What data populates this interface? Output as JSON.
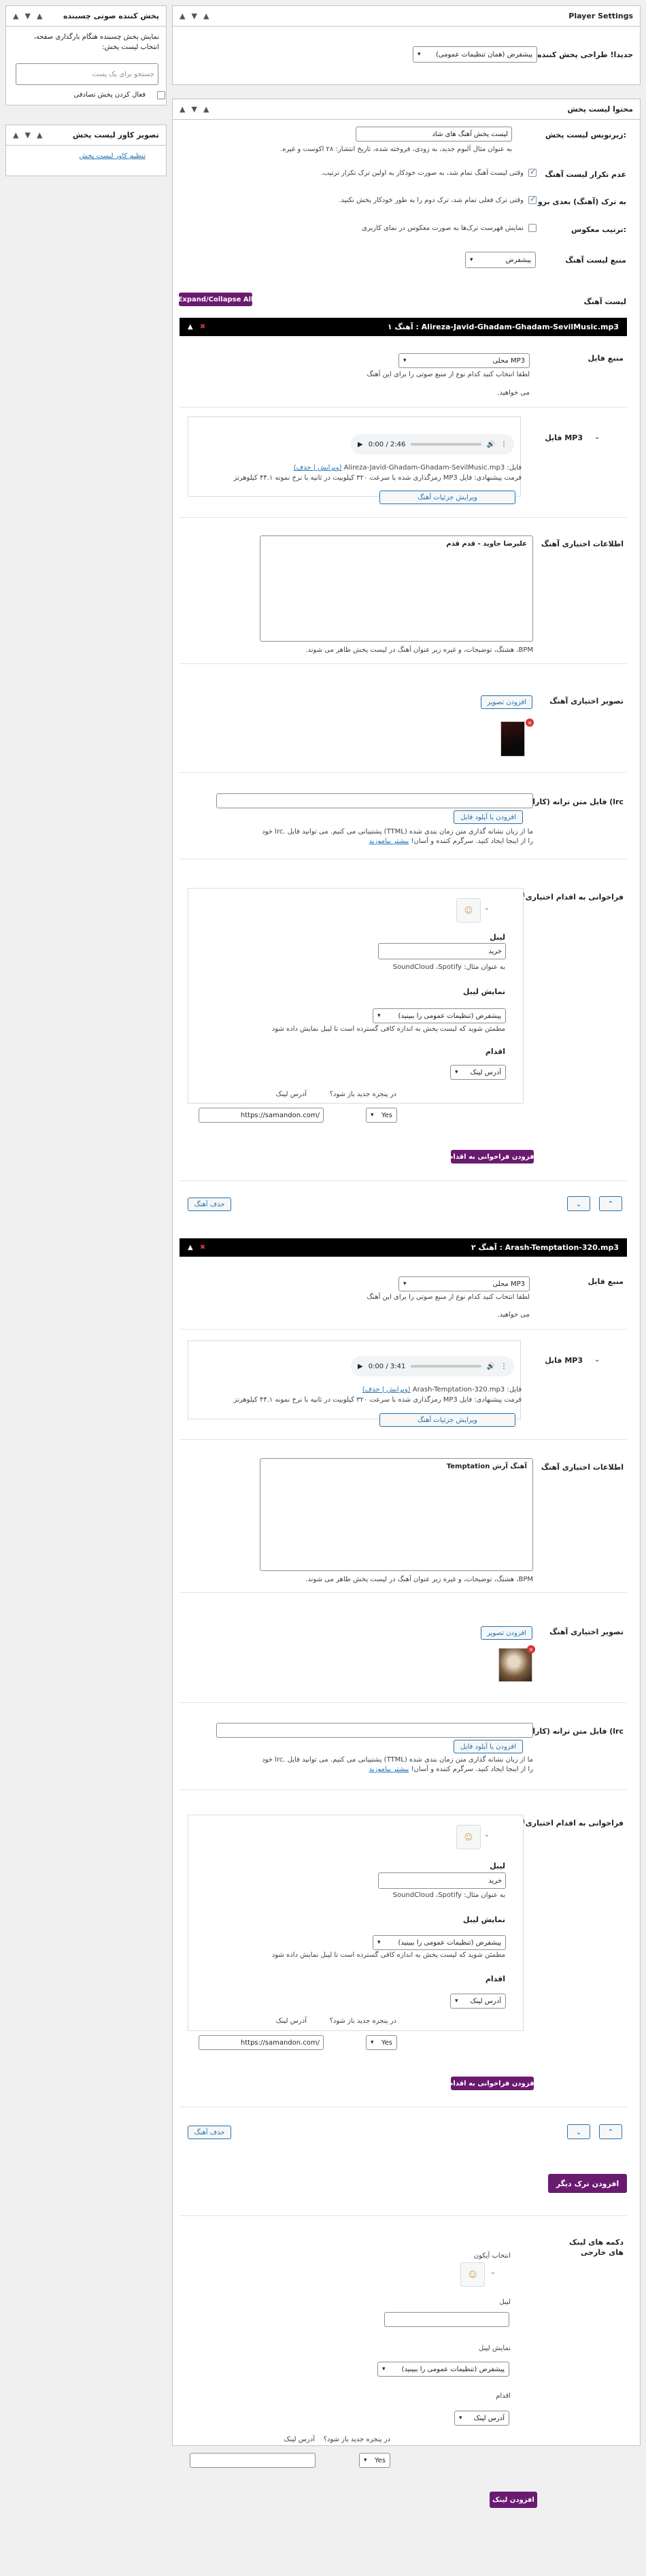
{
  "sidebar": {
    "sticky_panel": {
      "title": "پخش کننده صوتی چسبنده",
      "description": "نمایش پخش چسبنده هنگام بارگذاری صفحه، انتخاب لیست پخش:",
      "search_placeholder": "جستجو برای یک پست",
      "checkbox_label": "فعال کردن پخش تصادفی"
    },
    "cover_panel": {
      "title": "تصویر کاور لیست پخش",
      "link": "تنظیم کاور لیست پخش"
    }
  },
  "player_settings": {
    "title": "Player Settings",
    "row_label": "جدیدا! طراحی پخش کننده",
    "select_value": "پیشفرض (همان تنظیمات عمومی)"
  },
  "playlist_content": {
    "title": "محتوا لیست پخش",
    "subtitle_label": "زیرنویس لیست پخش:",
    "subtitle_value": "لیست پخش آهنگ های شاد",
    "subtitle_help": "به عنوان مثال آلبوم جدید، به زودی، فروخته شده، تاریخ انتشار: ۲۸ اکوست و غیره.",
    "no_loop_label": "عدم تکرار لیست آهنگ",
    "no_loop_text": "وقتی لیست آهنگ تمام شد، به صورت خودکار به اولین ترک تکرار ترتیب.",
    "next_track_label": "به ترک (آهنگ) بعدی برو",
    "next_track_text": "وقتی ترک فعلی تمام شد، ترک دوم را به طور خودکار پخش نکنید.",
    "reverse_label": "ترتیب معکوس:",
    "reverse_text": "نمایش فهرست ترک‌ها به صورت معکوس در نمای کاربری",
    "source_label": "منبع لیست آهنگ",
    "source_value": "پیشفرض",
    "list_label": "لیست آهنگ",
    "expand_button": "Expand/Collapse All"
  },
  "labels": {
    "source_file": "منبع فایل",
    "mp3_file": "فایل MP3",
    "track_info": "اطلاعات اختیاری آهنگ",
    "track_image": "تصویر اختیاری آهنگ",
    "lyrics_file": "فایل متن ترانه (کارائوکه (lrc",
    "cta": "فراخوانی به اقدام اختیاری",
    "icon_label": "آیکن",
    "label": "لیبل",
    "label_help": "به عنوان مثال: SoundCloud ،Spotify",
    "visibility": "نمایش لیبل",
    "visibility_help": "مطمئن شوید که لیست پخش به اندازه کافی گسترده است تا لیبل نمایش داده شود",
    "action": "اقدام",
    "new_window": "در پنجره جدید باز شود؟",
    "link_address": "آدرس لینک",
    "info_help": "BPM، هشتگ، توضیحات، و غیره زیر عنوان آهنگ در لیست پخش ظاهر می شوند.",
    "source_help": "لطفا انتخاب کنید کدام نوع از منبع صوتی را برای این آهنگ",
    "source_help2": "می خواهید.",
    "lyrics_help": "ما از زبان نشانه گذاری متن زمان بندی شده (TTML) پشتیبانی می کنیم. می توانید فایل .lrc خود را از اینجا ایجاد کنید. سرگرم کننده و آسان!",
    "lyrics_link": "بیشتر بیاموزید",
    "lyrics_link2": "اینجا",
    "edit_details": "ویرایش جزئیات آهنگ",
    "add_image": "افزودن تصویر",
    "upload_file": "افزودن یا آپلود فایل",
    "add_cta": "افزودن فراخوانی به اقدام",
    "delete_track": "حذف آهنگ"
  },
  "tracks": [
    {
      "header": "آهنگ ۱ : Alireza-Javid-Ghadam-Ghadam-SevilMusic.mp3",
      "source_value": "MP3 محلی",
      "player_time": "0:00 / 2:46",
      "file_name": "فایل: Alireza-Javid-Ghadam-Ghadam-SevilMusic.mp3",
      "file_links": "(ویرایش | حذف)",
      "file_hint": "فرمت پیشنهادی: فایل MP3 رمزگذاری شده با سرعت ۳۲۰ کیلوبیت در ثانیه با نرخ نمونه ۴۴.۱ کیلوهرتز",
      "info_value": "علیرضا جاوید - قدم قدم",
      "cta_label": "خرید",
      "cta_visibility": "پیشفرض (تنظیمات عمومی را ببینید)",
      "cta_action": "آدرس لینک",
      "cta_new_window": "Yes",
      "cta_url": "https://samandon.com/"
    },
    {
      "header": "آهنگ ۲ : Arash-Temptation-320.mp3",
      "source_value": "MP3 محلی",
      "player_time": "0:00 / 3:41",
      "file_name": "فایل: Arash-Temptation-320.mp3",
      "file_links": "(ویرایش | حذف)",
      "file_hint": "فرمت پیشنهادی: فایل MP3 رمزگذاری شده با سرعت ۳۲۰ کیلوبیت در ثانیه با نرخ نمونه ۴۴.۱ کیلوهرتز",
      "info_value": "آهنگ آرش Temptation",
      "cta_label": "خرید",
      "cta_visibility": "پیشفرض (تنظیمات عمومی را ببینید)",
      "cta_action": "آدرس لینک",
      "cta_new_window": "Yes",
      "cta_url": "https://samandon.com/"
    }
  ],
  "add_track_button": "افزودن ترک دیگر",
  "external_links": {
    "label": "دکمه های لینک های خارجی",
    "icon_choose": "انتخاب آیکون",
    "label_field": "لیبل",
    "visibility_field": "نمایش لیبل",
    "visibility_value": "پیشفرض (تنظیمات عمومی را ببینید)",
    "action_field": "اقدام",
    "action_value": "آدرس لینک",
    "new_window": "در پنجره جدید باز شود؟",
    "link_address": "آدرس لینک",
    "new_window_value": "Yes",
    "add_button": "افزودن لینک"
  },
  "header_controls": {
    "up": "▲",
    "down": "▼",
    "toggle": "▲"
  },
  "colors": {
    "accent": "#6a1b70",
    "link": "#2271b1",
    "track_bar": "#000000"
  }
}
